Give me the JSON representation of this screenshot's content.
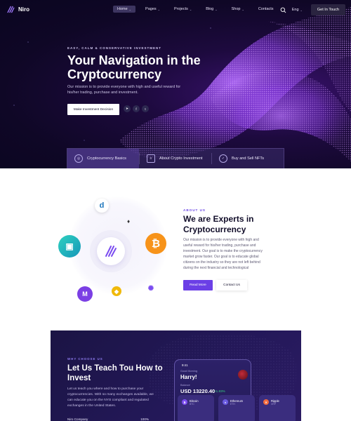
{
  "brand": {
    "name": "Niro"
  },
  "nav": {
    "items": [
      {
        "label": "Home",
        "active": true,
        "dropdown": true
      },
      {
        "label": "Pages",
        "active": false,
        "dropdown": true
      },
      {
        "label": "Projects",
        "active": false,
        "dropdown": true
      },
      {
        "label": "Blog",
        "active": false,
        "dropdown": true
      },
      {
        "label": "Shop",
        "active": false,
        "dropdown": true
      },
      {
        "label": "Contacts",
        "active": false,
        "dropdown": false
      }
    ],
    "language": "Eng",
    "cta_label": "Get In Touch"
  },
  "hero": {
    "eyebrow": "EASY, CALM & CONSERVATIVE INVESTMENT",
    "title": "Your Navigation in the Cryptocurrency",
    "description": "Our mission is to provide everyone with high and useful reward for his/her trading, purchase and investment.",
    "button_label": "Make Investment Decision",
    "socials": [
      "telegram-icon",
      "facebook-icon",
      "twitter-icon"
    ]
  },
  "features": [
    {
      "label": "Cryptocurrency Basics",
      "icon": "coins-icon"
    },
    {
      "label": "About Crypto Investment",
      "icon": "document-icon"
    },
    {
      "label": "Buy and Sell NFTs",
      "icon": "shield-icon"
    }
  ],
  "about": {
    "eyebrow": "ABOUT US",
    "title": "We are Experts in Cryptocurrency",
    "description": "Our mission is to provide everyone with high and useful reward for his/her trading, purchase and investment. Our goal is to make the cryptocurrency market grow faster. Our goal is to educate global citizens on the industry so they are not left behind during the next financial and technological",
    "primary_label": "Read More",
    "secondary_label": "Contact Us"
  },
  "invest": {
    "eyebrow": "WHY CHOOSE US",
    "title": "Let Us Teach Tou How to Invest",
    "description": "Let us teach you where and how to purchase your cryptocurrencies. With so many exchanges available, we can educate you on the NYS compliant and regulated exchanges in the United States.",
    "row_label": "Niro Company",
    "row_value": "100%",
    "phone": {
      "time": "9:41",
      "greeting": "Good Morning",
      "name": "Harry!",
      "balance_label": "Balance",
      "balance": "USD 13220.40",
      "change": "+1.83%",
      "coins": [
        {
          "name": "Bitcoin",
          "symbol": "BTC",
          "color": "#7b4cf0"
        },
        {
          "name": "Ethereum",
          "symbol": "ETH",
          "color": "#6a5be0"
        },
        {
          "name": "Ripple",
          "symbol": "XRP",
          "color": "#f26a3c"
        }
      ]
    }
  },
  "colors": {
    "accent": "#6b3fe6",
    "hero_bg": "#0f0726",
    "bitcoin": "#f7931a",
    "positive": "#35d07f"
  }
}
